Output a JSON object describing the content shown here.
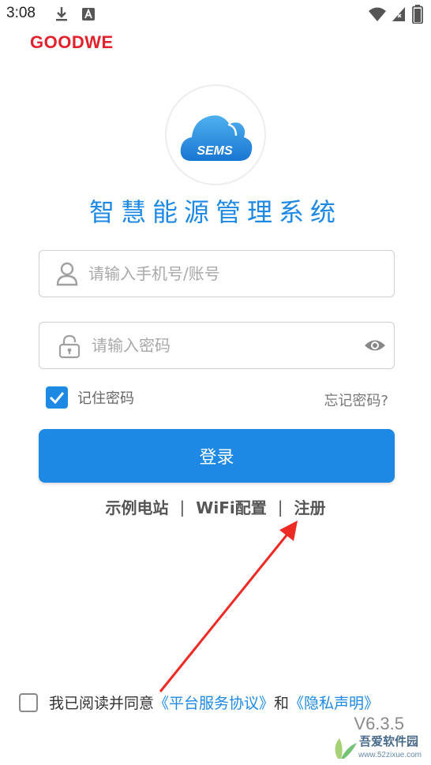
{
  "status_bar": {
    "time": "3:08",
    "icons": [
      "download-icon",
      "text-a-icon",
      "wifi-icon",
      "signal-icon",
      "battery-icon"
    ]
  },
  "brand": {
    "name": "GOODWE",
    "color": "#e2212c"
  },
  "app_logo": {
    "text": "SEMS",
    "icon": "cloud-icon"
  },
  "app_title": "智慧能源管理系统",
  "username_field": {
    "placeholder": "请输入手机号/账号",
    "value": "",
    "icon": "user-icon"
  },
  "password_field": {
    "placeholder": "请输入密码",
    "value": "",
    "icon": "lock-icon",
    "toggle_icon": "eye-icon"
  },
  "remember": {
    "label": "记住密码",
    "checked": true
  },
  "forgot_label": "忘记密码?",
  "login_label": "登录",
  "links": {
    "demo": "示例电站",
    "wifi": "WiFi配置",
    "register": "注册",
    "separator": "|"
  },
  "agreement": {
    "checked": false,
    "prefix": "我已阅读并同意",
    "terms": "《平台服务协议》",
    "and": "和",
    "privacy": "《隐私声明》"
  },
  "version": "V6.3.5",
  "watermark": {
    "text": "吾爱软件园",
    "url": "www.52zixue.com"
  },
  "colors": {
    "accent": "#1e88e5",
    "brand_red": "#e2212c",
    "annotation_arrow": "#ee2a24"
  }
}
